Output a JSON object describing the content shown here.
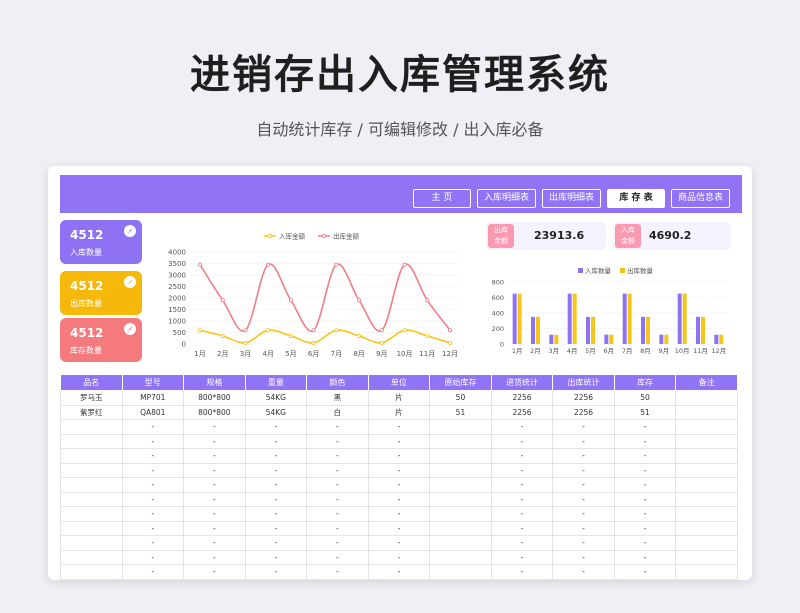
{
  "header": {
    "title": "进销存出入库管理系统",
    "subtitle": "自动统计库存 / 可编辑修改 / 出入库必备"
  },
  "nav": {
    "home": "主 页",
    "inbound": "入库明细表",
    "outbound": "出库明细表",
    "stock": "库 存 表",
    "product": "商品信息表"
  },
  "kpis": [
    {
      "value": "4512",
      "label": "入库数量",
      "color": "#8e72f3"
    },
    {
      "value": "4512",
      "label": "出库数量",
      "color": "#f7b80c"
    },
    {
      "value": "4512",
      "label": "库存数量",
      "color": "#f47a7d"
    }
  ],
  "stats": {
    "outbound_amount": {
      "tag": "出库\n金额",
      "value": "23913.6"
    },
    "inbound_amount": {
      "tag": "入库\n金额",
      "value": "4690.2"
    }
  },
  "chart_data": [
    {
      "type": "line",
      "legend": [
        "入库金额",
        "出库金额"
      ],
      "categories": [
        "1月",
        "2月",
        "3月",
        "4月",
        "5月",
        "6月",
        "7月",
        "8月",
        "9月",
        "10月",
        "11月",
        "12月"
      ],
      "ylim": [
        0,
        4000
      ],
      "yticks": [
        0,
        500,
        1000,
        1500,
        2000,
        2500,
        3000,
        3500,
        4000
      ],
      "series": [
        {
          "name": "入库金额",
          "color": "#f5c518",
          "values": [
            600,
            350,
            50,
            600,
            350,
            50,
            600,
            350,
            50,
            600,
            350,
            50
          ]
        },
        {
          "name": "出库金额",
          "color": "#f07f85",
          "values": [
            3450,
            1900,
            600,
            3450,
            1900,
            600,
            3450,
            1900,
            600,
            3450,
            1900,
            600
          ]
        }
      ]
    },
    {
      "type": "bar",
      "legend": [
        "入库数量",
        "出库数量"
      ],
      "categories": [
        "1月",
        "2月",
        "3月",
        "4月",
        "5月",
        "6月",
        "7月",
        "8月",
        "9月",
        "10月",
        "11月",
        "12月"
      ],
      "ylim": [
        0,
        800
      ],
      "yticks": [
        0,
        200,
        400,
        600,
        800
      ],
      "series": [
        {
          "name": "入库数量",
          "color": "#8e72f3",
          "values": [
            650,
            350,
            120,
            650,
            350,
            120,
            650,
            350,
            120,
            650,
            350,
            120
          ]
        },
        {
          "name": "出库数量",
          "color": "#f5c518",
          "values": [
            650,
            350,
            120,
            650,
            350,
            120,
            650,
            350,
            120,
            650,
            350,
            120
          ]
        }
      ]
    }
  ],
  "table": {
    "headers": [
      "品名",
      "型号",
      "规格",
      "重量",
      "颜色",
      "单位",
      "原始库存",
      "进货统计",
      "出库统计",
      "库存",
      "备注"
    ],
    "rows": [
      [
        "罗马玉",
        "MP701",
        "800*800",
        "54KG",
        "黑",
        "片",
        "50",
        "2256",
        "2256",
        "50",
        ""
      ],
      [
        "紫罗红",
        "QA801",
        "800*800",
        "54KG",
        "白",
        "片",
        "51",
        "2256",
        "2256",
        "51",
        ""
      ],
      [
        "",
        "-",
        "-",
        "-",
        "-",
        "-",
        "",
        "-",
        "-",
        "-",
        ""
      ],
      [
        "",
        "-",
        "-",
        "-",
        "-",
        "-",
        "",
        "-",
        "-",
        "-",
        ""
      ],
      [
        "",
        "-",
        "-",
        "-",
        "-",
        "-",
        "",
        "-",
        "-",
        "-",
        ""
      ],
      [
        "",
        "-",
        "-",
        "-",
        "-",
        "-",
        "",
        "-",
        "-",
        "-",
        ""
      ],
      [
        "",
        "-",
        "-",
        "-",
        "-",
        "-",
        "",
        "-",
        "-",
        "-",
        ""
      ],
      [
        "",
        "-",
        "-",
        "-",
        "-",
        "-",
        "",
        "-",
        "-",
        "-",
        ""
      ],
      [
        "",
        "-",
        "-",
        "-",
        "-",
        "-",
        "",
        "-",
        "-",
        "-",
        ""
      ],
      [
        "",
        "-",
        "-",
        "-",
        "-",
        "-",
        "",
        "-",
        "-",
        "-",
        ""
      ],
      [
        "",
        "-",
        "-",
        "-",
        "-",
        "-",
        "",
        "-",
        "-",
        "-",
        ""
      ],
      [
        "",
        "-",
        "-",
        "-",
        "-",
        "-",
        "",
        "-",
        "-",
        "-",
        ""
      ],
      [
        "",
        "-",
        "-",
        "-",
        "-",
        "-",
        "",
        "-",
        "-",
        "-",
        ""
      ]
    ]
  }
}
